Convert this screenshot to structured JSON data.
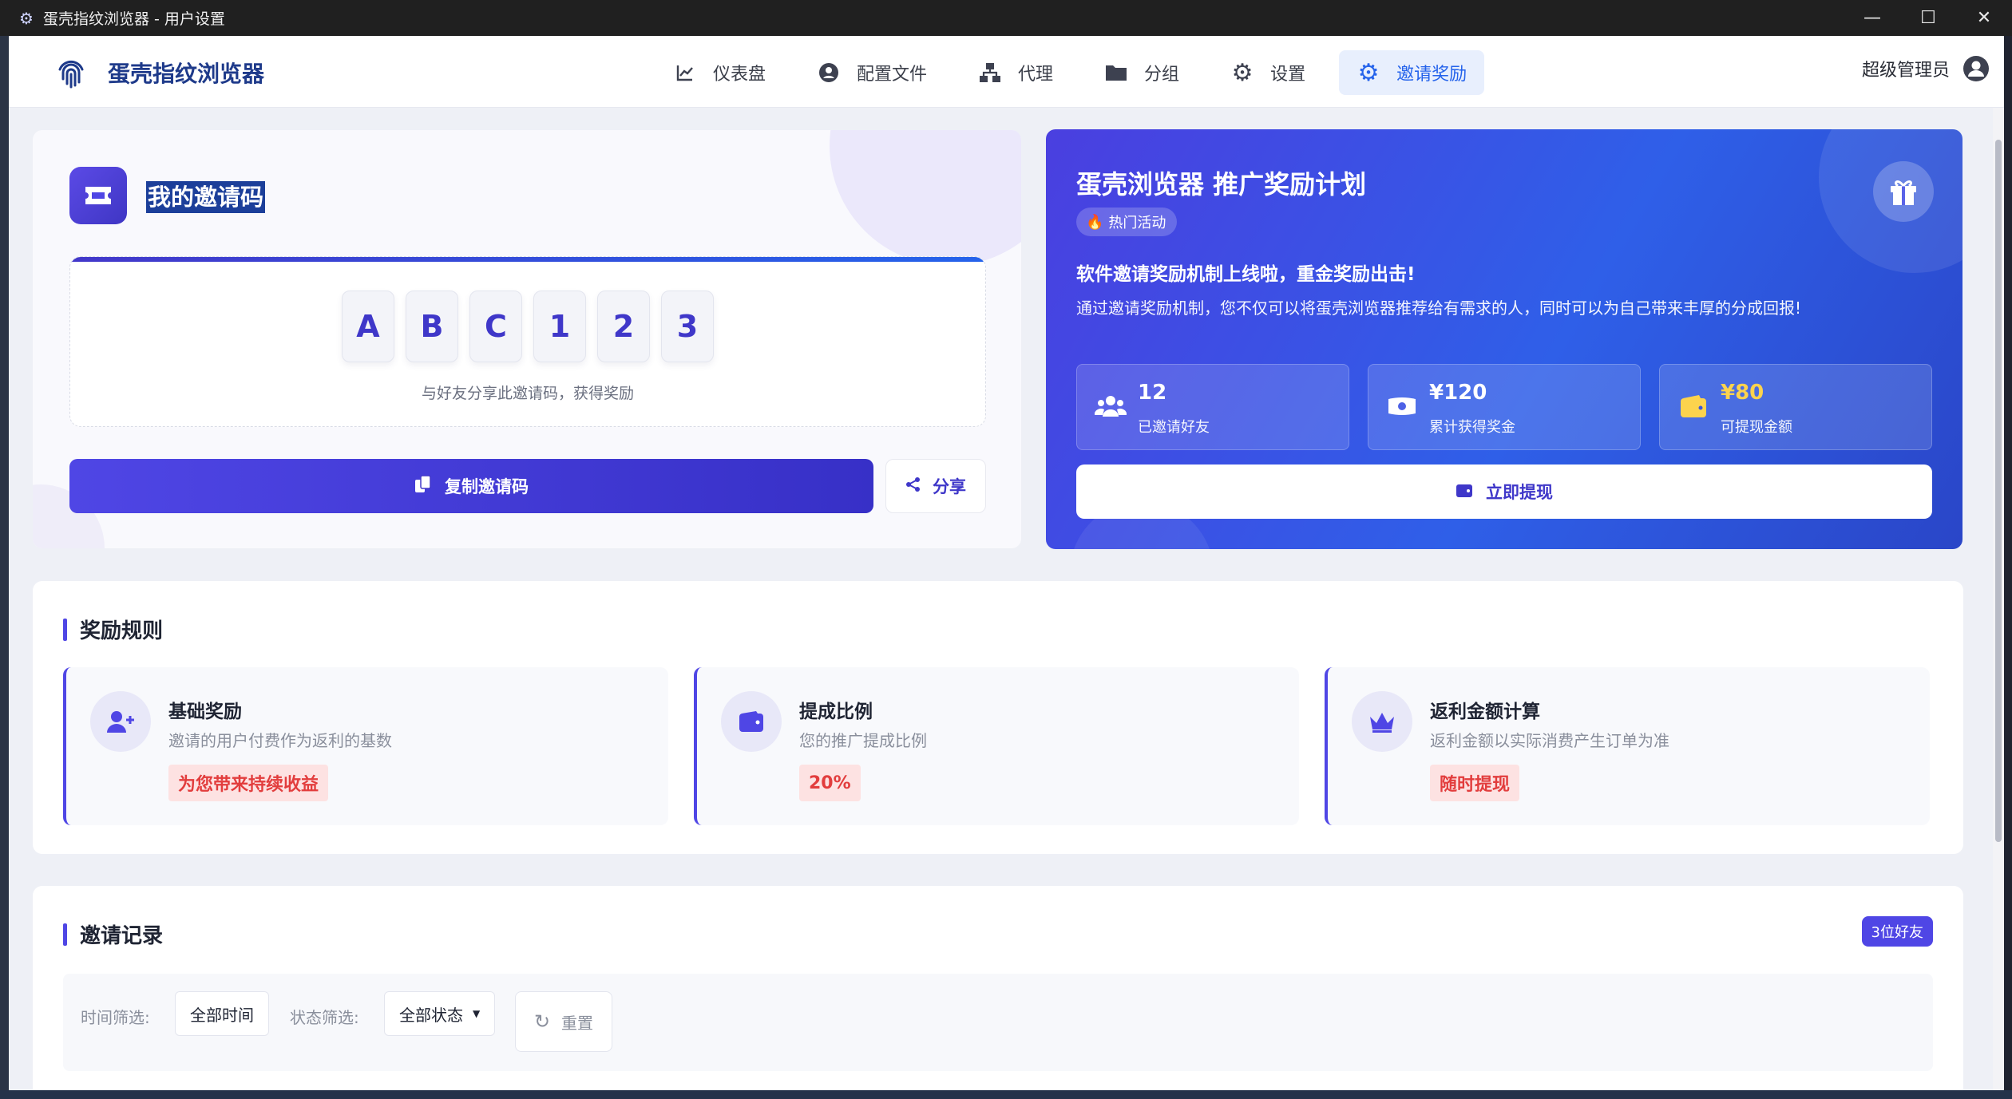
{
  "window": {
    "title": "蛋壳指纹浏览器 - 用户设置",
    "minimize_icon": "minimize-icon",
    "maximize_icon": "maximize-icon",
    "close_icon": "close-icon"
  },
  "nav": {
    "brand": "蛋壳指纹浏览器",
    "items": [
      {
        "label": "仪表盘",
        "icon": "chart-line-icon"
      },
      {
        "label": "配置文件",
        "icon": "user-circle-icon"
      },
      {
        "label": "代理",
        "icon": "network-icon"
      },
      {
        "label": "分组",
        "icon": "folder-icon"
      },
      {
        "label": "设置",
        "icon": "gear-icon"
      },
      {
        "label": "邀请奖励",
        "icon": "gear-icon",
        "active": true
      }
    ],
    "user": "超级管理员"
  },
  "invite": {
    "title": "我的邀请码",
    "code_chars": [
      "A",
      "B",
      "C",
      "1",
      "2",
      "3"
    ],
    "hint": "与好友分享此邀请码，获得奖励",
    "copy_label": "复制邀请码",
    "share_label": "分享"
  },
  "promo": {
    "title": "蛋壳浏览器 推广奖励计划",
    "badge": "热门活动",
    "headline": "软件邀请奖励机制上线啦，重金奖励出击!",
    "description": "通过邀请奖励机制，您不仅可以将蛋壳浏览器推荐给有需求的人，同时可以为自己带来丰厚的分成回报!",
    "stats": [
      {
        "value": "12",
        "label": "已邀请好友",
        "icon": "users-icon"
      },
      {
        "value": "¥120",
        "label": "累计获得奖金",
        "icon": "money-icon"
      },
      {
        "value": "¥80",
        "label": "可提现金额",
        "icon": "wallet-icon"
      }
    ],
    "withdraw_label": "立即提现"
  },
  "rules": {
    "title": "奖励规则",
    "items": [
      {
        "title": "基础奖励",
        "desc": "邀请的用户付费作为返利的基数",
        "tag": "为您带来持续收益",
        "icon": "user-plus-icon"
      },
      {
        "title": "提成比例",
        "desc": "您的推广提成比例",
        "tag": "20%",
        "icon": "wallet-icon"
      },
      {
        "title": "返利金额计算",
        "desc": "返利金额以实际消费产生订单为准",
        "tag": "随时提现",
        "icon": "crown-icon"
      }
    ]
  },
  "records": {
    "title": "邀请记录",
    "badge": "3位好友",
    "time_filter_label": "时间筛选:",
    "time_filter_value": "全部时间",
    "status_filter_label": "状态筛选:",
    "status_filter_value": "全部状态",
    "reset_label": "重置"
  },
  "colors": {
    "primary": "#4f46e5",
    "blue": "#2563eb",
    "gold": "#fcd34d",
    "danger": "#e23d3d"
  }
}
